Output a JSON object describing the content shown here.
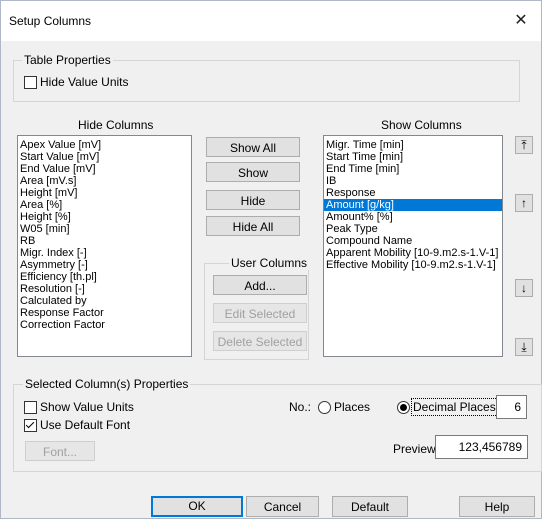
{
  "window": {
    "title": "Setup Columns",
    "close_glyph": "✕"
  },
  "table_properties": {
    "legend": "Table Properties",
    "hide_value_units": {
      "label": "Hide Value Units",
      "checked": false
    }
  },
  "hide_columns": {
    "header": "Hide Columns",
    "items": [
      "Apex Value [mV]",
      "Start Value [mV]",
      "End Value [mV]",
      "Area [mV.s]",
      "Height [mV]",
      "Area [%]",
      "Height [%]",
      "W05 [min]",
      "RB",
      "Migr. Index [-]",
      "Asymmetry [-]",
      "Efficiency [th.pl]",
      "Resolution [-]",
      "Calculated by",
      "Response Factor",
      "Correction Factor"
    ]
  },
  "show_columns": {
    "header": "Show Columns",
    "items": [
      "Migr. Time [min]",
      "Start Time [min]",
      "End Time [min]",
      "IB",
      "Response",
      "Amount [g/kg]",
      "Amount% [%]",
      "Peak Type",
      "Compound Name",
      "Apparent Mobility [10-9.m2.s-1.V-1]",
      "Effective Mobility [10-9.m2.s-1.V-1]"
    ],
    "selected_index": 5
  },
  "middle_buttons": {
    "show_all": "Show All",
    "show": "Show",
    "hide": "Hide",
    "hide_all": "Hide All"
  },
  "user_columns": {
    "legend": "User Columns",
    "add": "Add...",
    "edit_selected": "Edit Selected",
    "delete_selected": "Delete Selected"
  },
  "move_buttons": {
    "top": "⤒",
    "up": "↑",
    "down": "↓",
    "bottom": "⤓"
  },
  "selected_props": {
    "legend": "Selected Column(s) Properties",
    "show_value_units": {
      "label": "Show Value Units",
      "checked": false
    },
    "use_default_font": {
      "label": "Use Default Font",
      "checked": true
    },
    "font_button": "Font...",
    "no_label": "No.:",
    "places_label": "Places",
    "decimal_places_label": "Decimal Places",
    "decimal_places_selected": true,
    "decimal_value": "6",
    "preview_label": "Preview",
    "preview_value": "123,456789"
  },
  "footer": {
    "ok": "OK",
    "cancel": "Cancel",
    "default": "Default",
    "help": "Help"
  }
}
